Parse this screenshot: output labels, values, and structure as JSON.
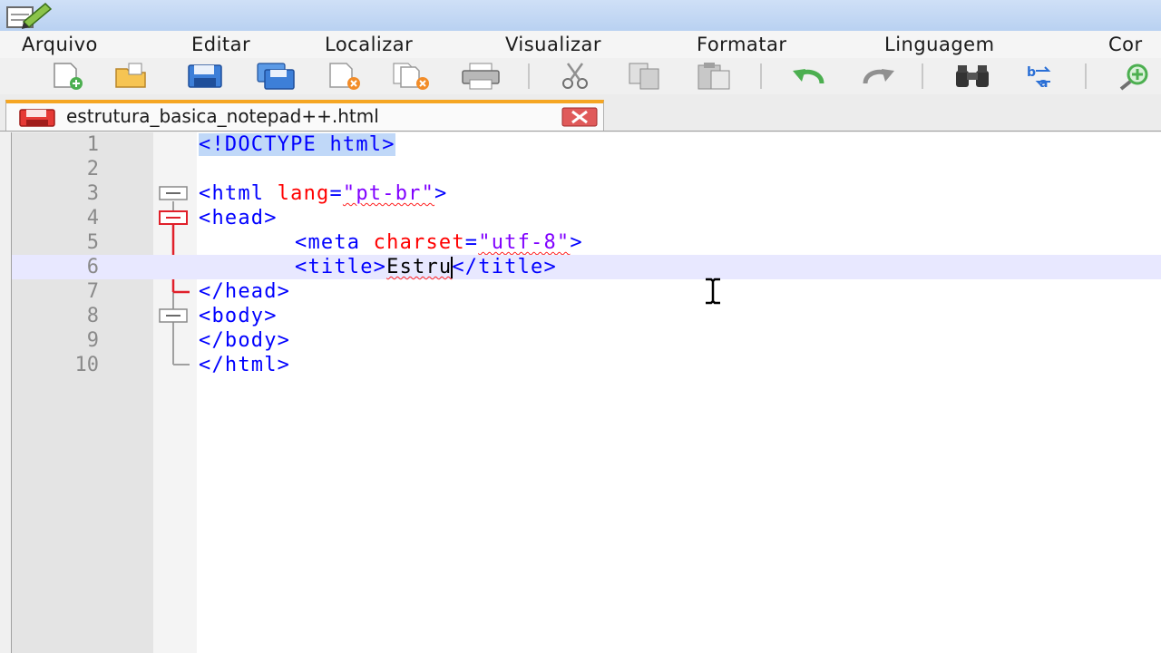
{
  "menu": {
    "items": [
      "Arquivo",
      "Editar",
      "Localizar",
      "Visualizar",
      "Formatar",
      "Linguagem",
      "Cor"
    ]
  },
  "toolbar": {
    "buttons": [
      "new-file-icon",
      "open-file-icon",
      "save-icon",
      "save-all-icon",
      "close-icon",
      "close-all-icon",
      "print-icon",
      "cut-icon",
      "copy-icon",
      "paste-icon",
      "undo-icon",
      "redo-icon",
      "find-icon",
      "replace-icon",
      "zoom-icon"
    ]
  },
  "tab": {
    "title": "estrutura_basica_notepad++.html"
  },
  "editor": {
    "lines": [
      {
        "n": "1",
        "parts": [
          "<!DOCTYPE html>"
        ]
      },
      {
        "n": "2",
        "parts": []
      },
      {
        "n": "3",
        "parts": [
          "<html",
          " lang",
          "=",
          "\"pt-br\"",
          ">"
        ]
      },
      {
        "n": "4",
        "parts": [
          "<head>"
        ]
      },
      {
        "n": "5",
        "parts": [
          "<meta",
          " charset",
          "=",
          "\"utf-8\"",
          ">"
        ]
      },
      {
        "n": "6",
        "parts": [
          "<title>",
          "Estru",
          "</title>"
        ]
      },
      {
        "n": "7",
        "parts": [
          "</head>"
        ]
      },
      {
        "n": "8",
        "parts": [
          "<body>"
        ]
      },
      {
        "n": "9",
        "parts": [
          "</body>"
        ]
      },
      {
        "n": "10",
        "parts": [
          "</html>"
        ]
      }
    ]
  },
  "colors": {
    "tag": "#0000ff",
    "attribute": "#ff0000",
    "value": "#8000ff",
    "selection": "#c0d8f8",
    "current_line": "#e8e8ff",
    "tab_accent": "#f5a623"
  }
}
